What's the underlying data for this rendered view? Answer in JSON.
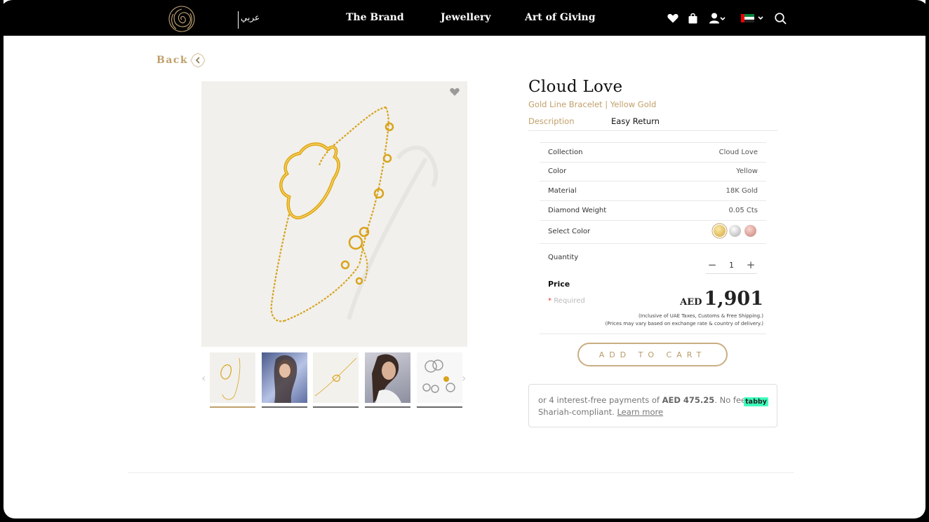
{
  "header": {
    "language_toggle": "عربي",
    "nav": [
      "The Brand",
      "Jewellery",
      "Art of Giving"
    ]
  },
  "back": {
    "label": "Back"
  },
  "product": {
    "title": "Cloud Love",
    "subtitle": "Gold Line Bracelet | Yellow Gold",
    "tabs": [
      "Description",
      "Easy Return"
    ],
    "specs": [
      {
        "key": "Collection",
        "value": "Cloud Love"
      },
      {
        "key": "Color",
        "value": "Yellow"
      },
      {
        "key": "Material",
        "value": "18K Gold"
      },
      {
        "key": "Diamond Weight",
        "value": "0.05 Cts"
      }
    ],
    "select_color_label": "Select Color",
    "color_options": [
      "yellow-gold",
      "white-gold",
      "rose-gold"
    ],
    "quantity_label": "Quantity",
    "quantity_value": "1",
    "price_label": "Price",
    "required_mark": "*",
    "required_text": "Required",
    "currency": "AED",
    "price": "1,901",
    "note1": "(Inclusive of UAE Taxes, Customs & Free Shipping.)",
    "note2": "(Prices may vary based on exchange rate & country of delivery.)",
    "add_to_cart": "ADD TO CART"
  },
  "tabby": {
    "text_before": "or 4 interest-free payments of ",
    "amount": "AED 475.25",
    "text_after": ". No fees.",
    "line2": "Shariah-compliant. ",
    "learn_more": "Learn more",
    "badge": "tabby"
  },
  "gallery": {
    "thumbnails": [
      "bracelet-product",
      "model-wearing-1",
      "bracelet-flat",
      "model-wearing-2",
      "collection-set"
    ],
    "active_index": 0
  },
  "colors": {
    "accent": "#c0a06a",
    "header_bg": "#000000",
    "tabby_green": "#3effbd"
  }
}
